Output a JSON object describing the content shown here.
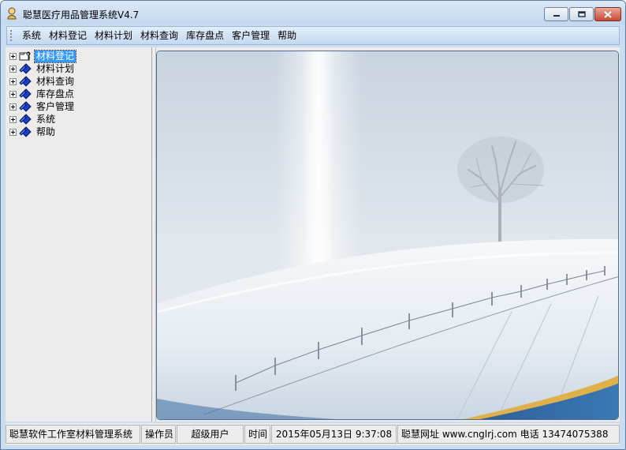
{
  "window": {
    "title": "聪慧医疗用品管理系统V4.7"
  },
  "menu": {
    "items": [
      "系统",
      "材料登记",
      "材料计划",
      "材料查询",
      "库存盘点",
      "客户管理",
      "帮助"
    ]
  },
  "tree": {
    "nodes": [
      {
        "label": "材料登记",
        "selected": true,
        "icon": "folder-key-icon"
      },
      {
        "label": "材料计划",
        "selected": false,
        "icon": "book-icon"
      },
      {
        "label": "材料查询",
        "selected": false,
        "icon": "book-icon"
      },
      {
        "label": "库存盘点",
        "selected": false,
        "icon": "book-icon"
      },
      {
        "label": "客户管理",
        "selected": false,
        "icon": "book-icon"
      },
      {
        "label": "系统",
        "selected": false,
        "icon": "book-icon"
      },
      {
        "label": "帮助",
        "selected": false,
        "icon": "book-icon"
      }
    ]
  },
  "statusbar": {
    "app_name": "聪慧软件工作室材料管理系统",
    "operator_label": "操作员",
    "operator_value": "超级用户",
    "time_label": "时间",
    "time_value": "2015年05月13日 9:37:08",
    "website": "聪慧网址 www.cnglrj.com 电话 13474075388"
  },
  "colors": {
    "title_bg": "#c9dcf0",
    "selection": "#3399ff",
    "close_button": "#c74a33"
  }
}
